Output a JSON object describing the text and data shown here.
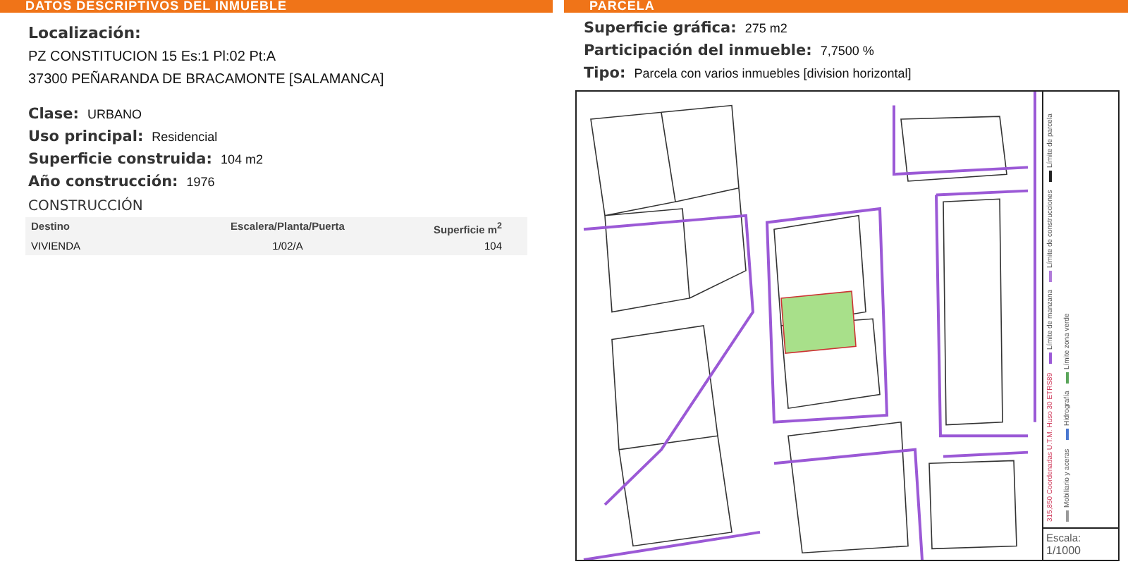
{
  "left": {
    "header": "DATOS DESCRIPTIVOS DEL INMUEBLE",
    "location": {
      "label": "Localización:",
      "lines": [
        "PZ CONSTITUCION 15 Es:1 Pl:02 Pt:A",
        "37300 PEÑARANDA DE BRACAMONTE [SALAMANCA]"
      ]
    },
    "fields": [
      {
        "label": "Clase:",
        "value": "URBANO"
      },
      {
        "label": "Uso principal:",
        "value": "Residencial"
      },
      {
        "label": "Superficie construida:",
        "value": "104 m2"
      },
      {
        "label": "Año construcción:",
        "value": "1976"
      }
    ],
    "construction": {
      "title": "CONSTRUCCIÓN",
      "columns": [
        "Destino",
        "Escalera/Planta/Puerta",
        "Superficie m$^{2}$"
      ],
      "rows": [
        [
          "VIVIENDA",
          "1/02/A",
          "104"
        ]
      ]
    }
  },
  "right": {
    "header": "PARCELA",
    "fields": [
      {
        "label": "Superficie gráfica:",
        "value": "275 m2"
      },
      {
        "label": "Participación del inmueble:",
        "value": "7,7500 %"
      },
      {
        "label": "Tipo:",
        "value": "Parcela con varios inmuebles [division horizontal]"
      }
    ],
    "legend": {
      "coords": "315,850 Coordenadas U.T.M. Huso 30 ETRS89",
      "items": [
        {
          "label": "Límite de manzana",
          "color": "#9b59d6"
        },
        {
          "label": "Límite de construcciones",
          "color": "#b07ad9"
        },
        {
          "label": "Límite de parcela",
          "color": "#222222"
        },
        {
          "label": "Mobiliario y aceras",
          "color": "#999999"
        },
        {
          "label": "Hidrografía",
          "color": "#4a78d0"
        },
        {
          "label": "Límite zona verde",
          "color": "#5aa55a"
        }
      ],
      "scale_label": "Escala:",
      "scale": "1/1000"
    }
  }
}
